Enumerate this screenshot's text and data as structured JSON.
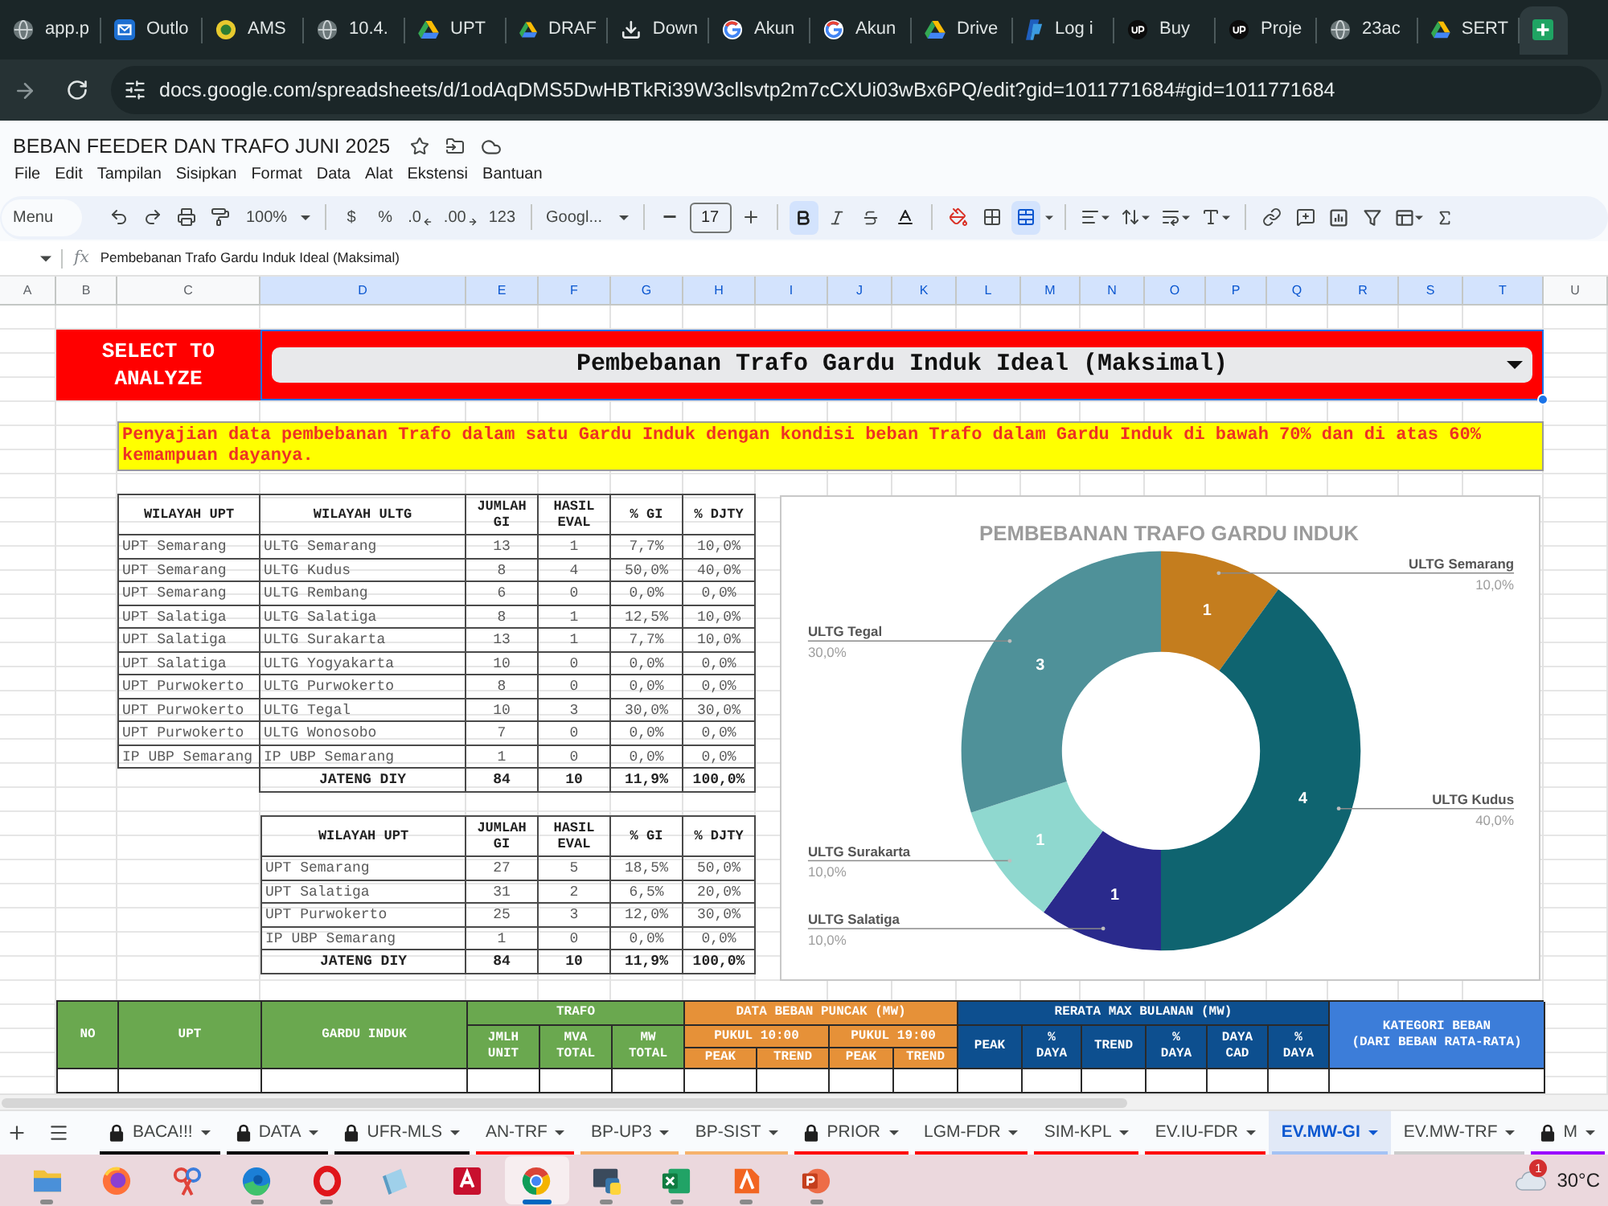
{
  "browser": {
    "tabs": [
      {
        "title": "app.p",
        "selected": false
      },
      {
        "title": "Outlo",
        "selected": false
      },
      {
        "title": "AMS",
        "selected": false
      },
      {
        "title": "10.4.",
        "selected": false
      },
      {
        "title": "UPT",
        "selected": false
      },
      {
        "title": "DRAF",
        "selected": false
      },
      {
        "title": "Down",
        "selected": false
      },
      {
        "title": "Akun",
        "selected": false
      },
      {
        "title": "Akun",
        "selected": false
      },
      {
        "title": "Drive",
        "selected": false
      },
      {
        "title": "Log i",
        "selected": false
      },
      {
        "title": "Buy",
        "selected": false
      },
      {
        "title": "Proje",
        "selected": false
      },
      {
        "title": "23ac",
        "selected": false
      },
      {
        "title": "SERT",
        "selected": false
      },
      {
        "selected": true
      }
    ],
    "address": "docs.google.com/spreadsheets/d/1odAqDMS5DwHBTkRi39W3cllsvtp2m7cCXUi03wBx6PQ/edit?gid=1011771684#gid=1011771684"
  },
  "document": {
    "title": "BEBAN FEEDER DAN TRAFO JUNI 2025",
    "menu": [
      "File",
      "Edit",
      "Tampilan",
      "Sisipkan",
      "Format",
      "Data",
      "Alat",
      "Ekstensi",
      "Bantuan"
    ]
  },
  "toolbar": {
    "search_label": "Menu",
    "zoom": "100%",
    "currency": "$",
    "percent": "%",
    "decrease_decimals": ".0",
    "increase_decimals": ".00",
    "number_formats": "123",
    "font": "Googl...",
    "font_size": "17",
    "bold": true,
    "merge": true
  },
  "formula_bar": {
    "fx_label": "fx",
    "formula": "Pembebanan Trafo Gardu Induk Ideal (Maksimal)"
  },
  "columns": [
    {
      "label": "A",
      "selected": false
    },
    {
      "label": "B",
      "selected": false
    },
    {
      "label": "C",
      "selected": false
    },
    {
      "label": "D",
      "selected": true
    },
    {
      "label": "E",
      "selected": true
    },
    {
      "label": "F",
      "selected": true
    },
    {
      "label": "G",
      "selected": true
    },
    {
      "label": "H",
      "selected": true
    },
    {
      "label": "I",
      "selected": true
    },
    {
      "label": "J",
      "selected": true
    },
    {
      "label": "K",
      "selected": true
    },
    {
      "label": "L",
      "selected": true
    },
    {
      "label": "M",
      "selected": true
    },
    {
      "label": "N",
      "selected": true
    },
    {
      "label": "O",
      "selected": true
    },
    {
      "label": "P",
      "selected": true
    },
    {
      "label": "Q",
      "selected": true
    },
    {
      "label": "R",
      "selected": true
    },
    {
      "label": "S",
      "selected": true
    },
    {
      "label": "T",
      "selected": true
    },
    {
      "label": "U",
      "selected": false
    }
  ],
  "sheet": {
    "selector_label": "SELECT TO ANALYZE",
    "selected_option": "Pembebanan Trafo Gardu Induk Ideal (Maksimal)",
    "note": "Penyajian data pembebanan Trafo dalam satu Gardu Induk dengan kondisi beban Trafo dalam Gardu Induk di bawah 70% dan di atas 60% kemampuan dayanya.",
    "ultg_table": {
      "columns": [
        "WILAYAH UPT",
        "WILAYAH ULTG",
        "JUMLAH GI",
        "HASIL EVAL",
        "% GI",
        "% DJTY"
      ],
      "rows": [
        [
          "UPT Semarang",
          "ULTG Semarang",
          "13",
          "1",
          "7,7%",
          "10,0%"
        ],
        [
          "UPT Semarang",
          "ULTG Kudus",
          "8",
          "4",
          "50,0%",
          "40,0%"
        ],
        [
          "UPT Semarang",
          "ULTG Rembang",
          "6",
          "0",
          "0,0%",
          "0,0%"
        ],
        [
          "UPT Salatiga",
          "ULTG Salatiga",
          "8",
          "1",
          "12,5%",
          "10,0%"
        ],
        [
          "UPT Salatiga",
          "ULTG Surakarta",
          "13",
          "1",
          "7,7%",
          "10,0%"
        ],
        [
          "UPT Salatiga",
          "ULTG Yogyakarta",
          "10",
          "0",
          "0,0%",
          "0,0%"
        ],
        [
          "UPT Purwokerto",
          "ULTG Purwokerto",
          "8",
          "0",
          "0,0%",
          "0,0%"
        ],
        [
          "UPT Purwokerto",
          "ULTG Tegal",
          "10",
          "3",
          "30,0%",
          "30,0%"
        ],
        [
          "UPT Purwokerto",
          "ULTG Wonosobo",
          "7",
          "0",
          "0,0%",
          "0,0%"
        ],
        [
          "IP UBP Semarang",
          "IP UBP Semarang",
          "1",
          "0",
          "0,0%",
          "0,0%"
        ]
      ],
      "total": {
        "label": "JATENG DIY",
        "values": [
          "84",
          "10",
          "11,9%",
          "100,0%"
        ]
      }
    },
    "upt_table": {
      "columns": [
        "WILAYAH UPT",
        "JUMLAH GI",
        "HASIL EVAL",
        "% GI",
        "% DJTY"
      ],
      "rows": [
        [
          "UPT Semarang",
          "27",
          "5",
          "18,5%",
          "50,0%"
        ],
        [
          "UPT Salatiga",
          "31",
          "2",
          "6,5%",
          "20,0%"
        ],
        [
          "UPT Purwokerto",
          "25",
          "3",
          "12,0%",
          "30,0%"
        ],
        [
          "IP UBP Semarang",
          "1",
          "0",
          "0,0%",
          "0,0%"
        ]
      ],
      "total": {
        "label": "JATENG DIY",
        "values": [
          "84",
          "10",
          "11,9%",
          "100,0%"
        ]
      }
    },
    "chart_data": [
      {
        "type": "donut",
        "title": "PEMBEBANAN TRAFO GARDU INDUK",
        "categories": [
          "ULTG Semarang",
          "ULTG Kudus",
          "ULTG Salatiga",
          "ULTG Surakarta",
          "ULTG Tegal"
        ],
        "values": [
          1,
          4,
          1,
          1,
          3
        ],
        "colors": [
          "#c47d1e",
          "#0f6470",
          "#2a2a8c",
          "#8fd8cf",
          "#4f9199"
        ],
        "data_labels": true,
        "value_labels": [
          "1",
          "4",
          "1",
          "1",
          "3"
        ],
        "annotations": [
          "10,0%",
          "40,0%",
          "10,0%",
          "10,0%",
          "30,0%"
        ]
      }
    ],
    "evaluation_table": {
      "columns": [
        {
          "kind": "single",
          "label": "NO",
          "color": "#6aa84f"
        },
        {
          "kind": "single",
          "label": "UPT",
          "color": "#6aa84f"
        },
        {
          "kind": "single",
          "label": "GARDU INDUK",
          "color": "#6aa84f"
        },
        {
          "kind": "group",
          "label": "TRAFO",
          "color": "#6aa84f",
          "subcolumns": [
            "JMLH UNIT",
            "MVA TOTAL",
            "MW TOTAL"
          ]
        },
        {
          "kind": "nested",
          "label": "DATA BEBAN PUNCAK (MW)",
          "color": "#e69138",
          "subgroups": [
            {
              "label": "PUKUL 10:00",
              "subcolumns": [
                "PEAK",
                "TREND"
              ]
            },
            {
              "label": "PUKUL 19:00",
              "subcolumns": [
                "PEAK",
                "TREND"
              ]
            }
          ]
        },
        {
          "kind": "group",
          "label": "RERATA MAX BULANAN (MW)",
          "color": "#0d4f8f",
          "subcolumns": [
            "PEAK",
            "% DAYA",
            "TREND",
            "% DAYA",
            "DAYA CAD",
            "% DAYA"
          ]
        },
        {
          "kind": "single",
          "label": "KATEGORI BEBAN\n(DARI BEBAN RATA-RATA)",
          "color": "#3c7dd9"
        }
      ]
    }
  },
  "sheet_tabs": [
    {
      "label": "BACA!!!",
      "locked": true,
      "selected": false,
      "color": "#000000"
    },
    {
      "label": "DATA",
      "locked": true,
      "selected": false,
      "color": "#000000"
    },
    {
      "label": "UFR-MLS",
      "locked": true,
      "selected": false,
      "color": "#000000"
    },
    {
      "label": "AN-TRF",
      "locked": false,
      "selected": false,
      "color": "#ff0000"
    },
    {
      "label": "BP-UP3",
      "locked": false,
      "selected": false,
      "color": "#f6b26b"
    },
    {
      "label": "BP-SIST",
      "locked": false,
      "selected": false,
      "color": "#f6b26b"
    },
    {
      "label": "PRIOR",
      "locked": true,
      "selected": false,
      "color": "#ff0000"
    },
    {
      "label": "LGM-FDR",
      "locked": false,
      "selected": false,
      "color": "#ff0000"
    },
    {
      "label": "SIM-KPL",
      "locked": false,
      "selected": false,
      "color": "#ff0000"
    },
    {
      "label": "EV.IU-FDR",
      "locked": false,
      "selected": false,
      "color": "#ff0000"
    },
    {
      "label": "EV.MW-GI",
      "locked": false,
      "selected": true,
      "color": "#a4c2f4"
    },
    {
      "label": "EV.MW-TRF",
      "locked": false,
      "selected": false,
      "color": "#cccccc"
    },
    {
      "label": "M",
      "locked": true,
      "selected": false,
      "color": "#9900ff"
    }
  ],
  "taskbar": {
    "apps": [
      {
        "running": true,
        "selected": false
      },
      {
        "running": false,
        "selected": false
      },
      {
        "running": false,
        "selected": false
      },
      {
        "running": true,
        "selected": false
      },
      {
        "running": true,
        "selected": false
      },
      {
        "running": false,
        "selected": false
      },
      {
        "running": false,
        "selected": false
      },
      {
        "running": true,
        "selected": true
      },
      {
        "running": true,
        "selected": false
      },
      {
        "running": true,
        "selected": false
      },
      {
        "running": true,
        "selected": false
      },
      {
        "running": true,
        "selected": false
      }
    ],
    "weather": {
      "badge": "1",
      "temperature": "30°C"
    }
  }
}
